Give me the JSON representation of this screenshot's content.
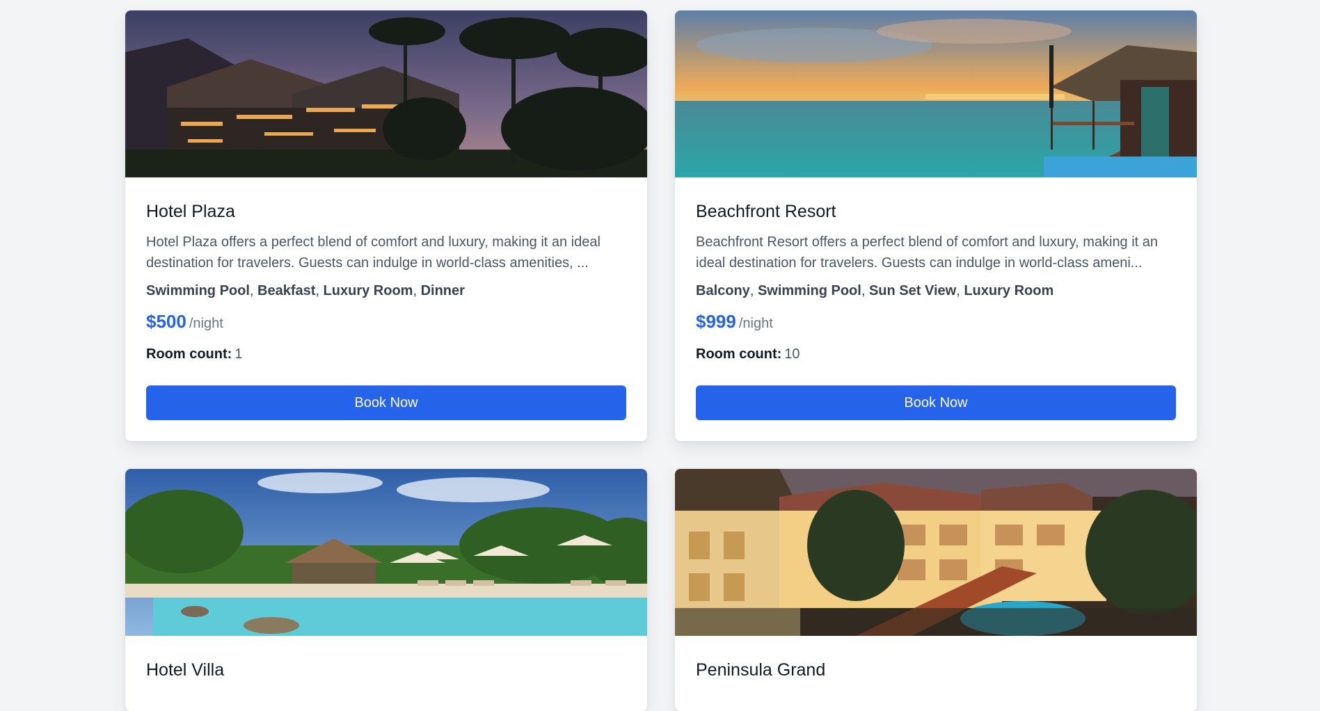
{
  "hotels": [
    {
      "name": "Hotel Plaza",
      "description": "Hotel Plaza offers a perfect blend of comfort and luxury, making it an ideal destination for travelers. Guests can indulge in world-class amenities, ...",
      "amenities": [
        "Swimming Pool",
        "Beakfast",
        "Luxury Room",
        "Dinner"
      ],
      "price": "$500",
      "per_night": "/night",
      "room_count_label": "Room count:",
      "room_count": "1",
      "book_label": "Book Now"
    },
    {
      "name": "Beachfront Resort",
      "description": "Beachfront Resort offers a perfect blend of comfort and luxury, making it an ideal destination for travelers. Guests can indulge in world-class ameni...",
      "amenities": [
        "Balcony",
        "Swimming Pool",
        "Sun Set View",
        "Luxury Room"
      ],
      "price": "$999",
      "per_night": "/night",
      "room_count_label": "Room count:",
      "room_count": "10",
      "book_label": "Book Now"
    },
    {
      "name": "Hotel Villa"
    },
    {
      "name": "Peninsula Grand"
    }
  ],
  "colors": {
    "accent": "#2563eb",
    "background": "#f3f4f6"
  }
}
